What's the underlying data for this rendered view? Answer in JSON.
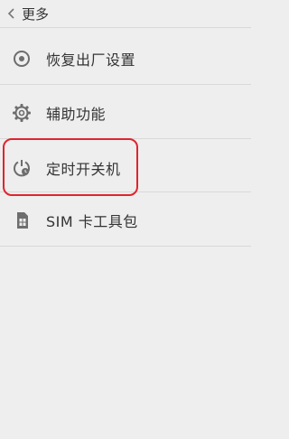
{
  "header": {
    "title": "更多",
    "back_icon": "chevron-left-icon"
  },
  "menu": {
    "items": [
      {
        "label": "恢复出厂设置",
        "icon": "factory-reset-icon"
      },
      {
        "label": "辅助功能",
        "icon": "gear-icon"
      },
      {
        "label": "定时开关机",
        "icon": "scheduled-power-icon"
      },
      {
        "label": "SIM 卡工具包",
        "icon": "sim-card-icon"
      }
    ]
  },
  "colors": {
    "background": "#eeeeee",
    "highlight": "#e0242d",
    "divider": "#d9d9d9"
  }
}
